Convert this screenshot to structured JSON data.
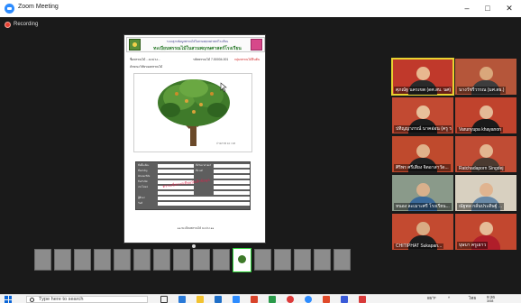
{
  "window": {
    "title": "Zoom Meeting",
    "minimize": "–",
    "maximize": "□",
    "close": "✕"
  },
  "recording": {
    "label": "Recording"
  },
  "document": {
    "subheader": "ระบบฐานข้อมูลพรรณไม้ในสวนพฤกษศาสตร์โรงเรียน",
    "title": "ทะเบียนพรรณไม้ในสวนพฤกษศาสตร์โรงเรียน",
    "field_left": "ชื่อพรรณไม้ ...มะม่วง...",
    "field_right": "รหัสพรรณไม้ 7-50004-001",
    "field_right_red": "กลุ่มพรรณไม้ยืนต้น",
    "section_label": "ลักษณะวิสัยของพรรณไม้",
    "photo_caption": "ถ่ายภาพ 10 / 08",
    "annotation": "ตรวจเช็คการเขียนบันทึกข้อมูล",
    "footer": "๑๑ ทะเบียนพรรณไม้ มะม่วง ๑๑",
    "table_labels": [
      "ชื่อพื้นเมือง",
      "ชื่อวิทยาศาสตร์",
      "ชื่อสามัญ",
      "ชื่อวงศ์",
      "ลักษณะวิสัย",
      "ถิ่นกำเนิด",
      "ประโยชน์",
      "ผู้ศึกษา",
      "วันที่"
    ]
  },
  "thumbnails": {
    "count": 16,
    "active_index": 10
  },
  "participants": [
    {
      "name": "ศุภณัฐ นครเขต (ดศ.สบ. นศ)",
      "active": true,
      "bg": "#c0392b",
      "skin": "#e8b88f",
      "shirt": "#2a2a2a"
    },
    {
      "name": "นางวัชรีวรรณ (มศ.สธ.)",
      "active": false,
      "bg": "#b5563a",
      "skin": "#d9a77b",
      "shirt": "#3d3d3d"
    },
    {
      "name": "ปทิญญาภรณ์ นาคอ่อน (ครู รร.)",
      "active": false,
      "bg": "#c24a32",
      "skin": "#e7c09a",
      "shirt": "#1d1d1d"
    },
    {
      "name": "Varunyupa khayanon",
      "active": false,
      "bg": "#c0432d",
      "skin": "#e4b996",
      "shirt": "#1a1a1a"
    },
    {
      "name": "ศิริพร ศรีเสียง จิตอาสาวัด...",
      "active": false,
      "bg": "#bf4a2d",
      "skin": "#e0b28a",
      "shirt": "#222222"
    },
    {
      "name": "Ratchadaporn Singdej",
      "active": false,
      "bg": "#c04c34",
      "skin": "#e3b690",
      "shirt": "#4a3a30"
    },
    {
      "name": "หนอง ละเมาะศรี โรงเรียน...",
      "active": false,
      "bg": "#8a9a8a",
      "skin": "#d8b08c",
      "shirt": "#3a6a9a"
    },
    {
      "name": "ณัฐพล กลั่นประดิษฐ์ ...",
      "active": false,
      "bg": "#d8d0c0",
      "skin": "#e0b490",
      "shirt": "#6a8aa8"
    },
    {
      "name": "CHITIPHAT Sukapan...",
      "active": false,
      "bg": "#c34a30",
      "skin": "#d9ac84",
      "shirt": "#1d1d1d"
    },
    {
      "name": "บุษบา ครูเยาว",
      "active": false,
      "bg": "#c2472f",
      "skin": "#e6bc98",
      "shirt": "#b01e2a"
    }
  ],
  "taskbar": {
    "search_placeholder": "Type here to search",
    "temperature": "85°F",
    "language": "ไทย",
    "time": "9:26",
    "date": "3/08"
  },
  "colors": {
    "meeting_bg": "#1a1a1a",
    "active_speaker": "#e8d230",
    "recording_red": "#e64032",
    "tile_red": "#c0432d"
  }
}
